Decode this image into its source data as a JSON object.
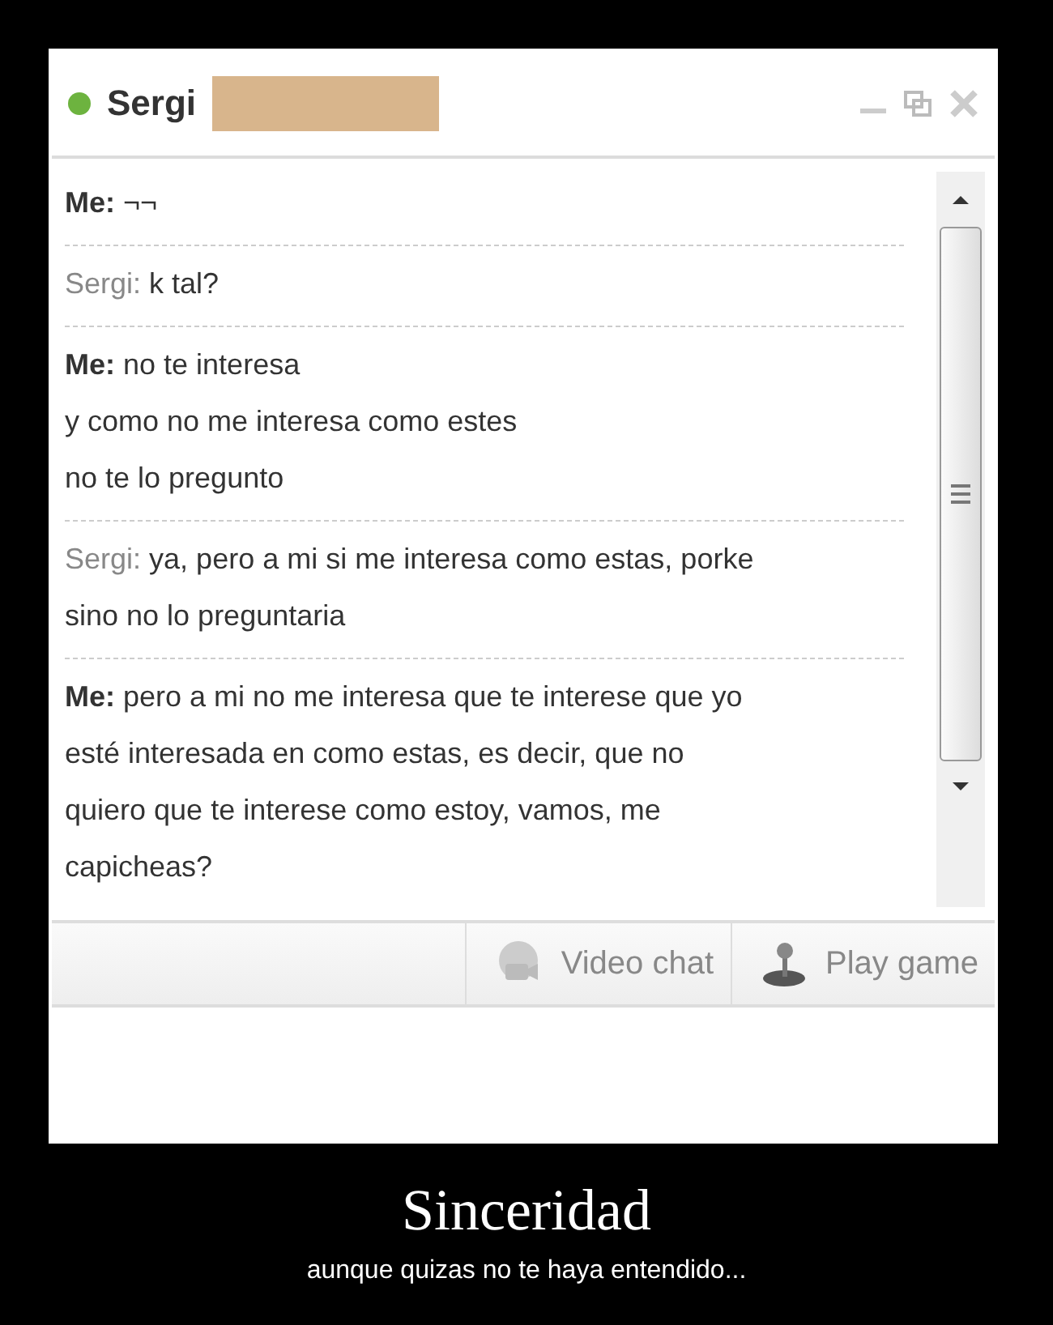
{
  "chat_window": {
    "contact": "Sergi",
    "online": true,
    "messages": [
      {
        "kind": "me",
        "speaker": "Me:",
        "lines": [
          "¬¬"
        ]
      },
      {
        "kind": "other",
        "speaker": "Sergi:",
        "lines": [
          "k tal?"
        ]
      },
      {
        "kind": "me",
        "speaker": "Me:",
        "lines": [
          "no te interesa",
          "y como no me interesa como estes",
          "no te lo pregunto"
        ]
      },
      {
        "kind": "other",
        "speaker": "Sergi:",
        "lines": [
          "ya, pero a mi si me interesa como estas, porke",
          "sino no lo preguntaria"
        ]
      },
      {
        "kind": "me",
        "speaker": "Me:",
        "lines": [
          "pero a mi no me interesa que te interese que yo",
          "esté interesada en como estas, es decir, que no",
          "quiero que te interese como estoy, vamos, me",
          "capicheas?"
        ]
      }
    ],
    "toolbar": [
      {
        "kind": "video",
        "label": "Video chat"
      },
      {
        "kind": "game",
        "label": "Play game"
      }
    ]
  },
  "poster": {
    "title": "Sinceridad",
    "caption": "aunque quizas no te haya entendido..."
  }
}
